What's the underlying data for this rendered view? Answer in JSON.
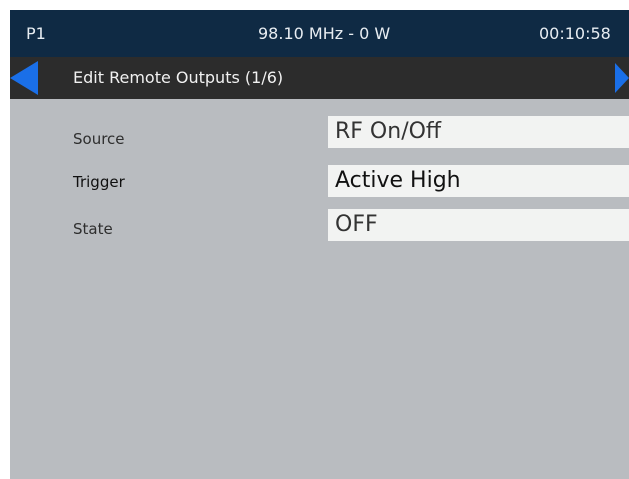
{
  "status_bar": {
    "preset": "P1",
    "frequency_power": "98.10 MHz - 0 W",
    "clock": "00:10:58"
  },
  "title_bar": {
    "title": "Edit Remote Outputs (1/6)",
    "left_icon": "arrow-left-icon",
    "right_icon": "arrow-right-icon"
  },
  "settings": [
    {
      "label": "Source",
      "value": "RF On/Off"
    },
    {
      "label": "Trigger",
      "value": "Active High"
    },
    {
      "label": "State",
      "value": "OFF"
    }
  ],
  "colors": {
    "status_bar_bg": "#0f2a44",
    "title_bar_bg": "#2c2c2c",
    "arrow_blue": "#1a6fe8",
    "panel_bg": "#b9bcc0",
    "value_box_bg": "#f2f3f2"
  }
}
